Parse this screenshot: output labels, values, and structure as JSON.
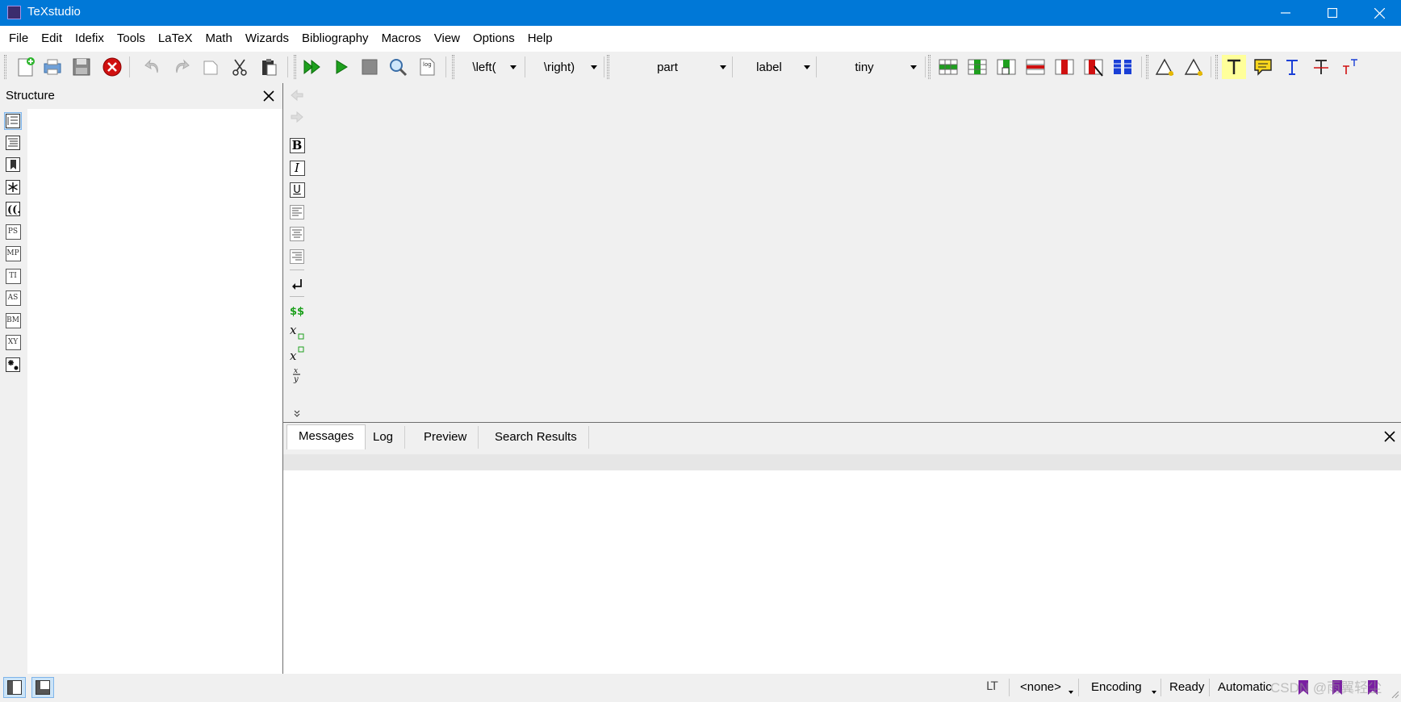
{
  "window": {
    "title": "TeXstudio",
    "controls": {
      "minimize_icon": "minimize-icon",
      "maximize_icon": "maximize-icon",
      "close_icon": "close-icon"
    }
  },
  "menubar": [
    "File",
    "Edit",
    "Idefix",
    "Tools",
    "LaTeX",
    "Math",
    "Wizards",
    "Bibliography",
    "Macros",
    "View",
    "Options",
    "Help"
  ],
  "toolbar": {
    "left_combo": "\\left(",
    "right_combo": "\\right)",
    "section_combo": "part",
    "ref_combo": "label",
    "size_combo": "tiny",
    "log_label": "log"
  },
  "structure": {
    "title": "Structure",
    "sidebar_icon_labels": [
      "PS",
      "MP",
      "TI",
      "AS",
      "BM",
      "XY"
    ]
  },
  "editor_vtoolbar": {
    "bold": "B",
    "italic": "I",
    "underline": "U",
    "math": "$$"
  },
  "bottom_panel": {
    "tabs": [
      "Messages",
      "Log",
      "Preview",
      "Search Results"
    ],
    "active_tab": "Messages"
  },
  "statusbar": {
    "lt": "LT",
    "dictionary": "<none>",
    "encoding": "Encoding",
    "status": "Ready",
    "mode": "Automatic"
  },
  "watermark": "CSDN @雨翼轻尘",
  "colors": {
    "titlebar": "#0078d7",
    "accent_green": "#1ea01e",
    "accent_red": "#d01010"
  }
}
